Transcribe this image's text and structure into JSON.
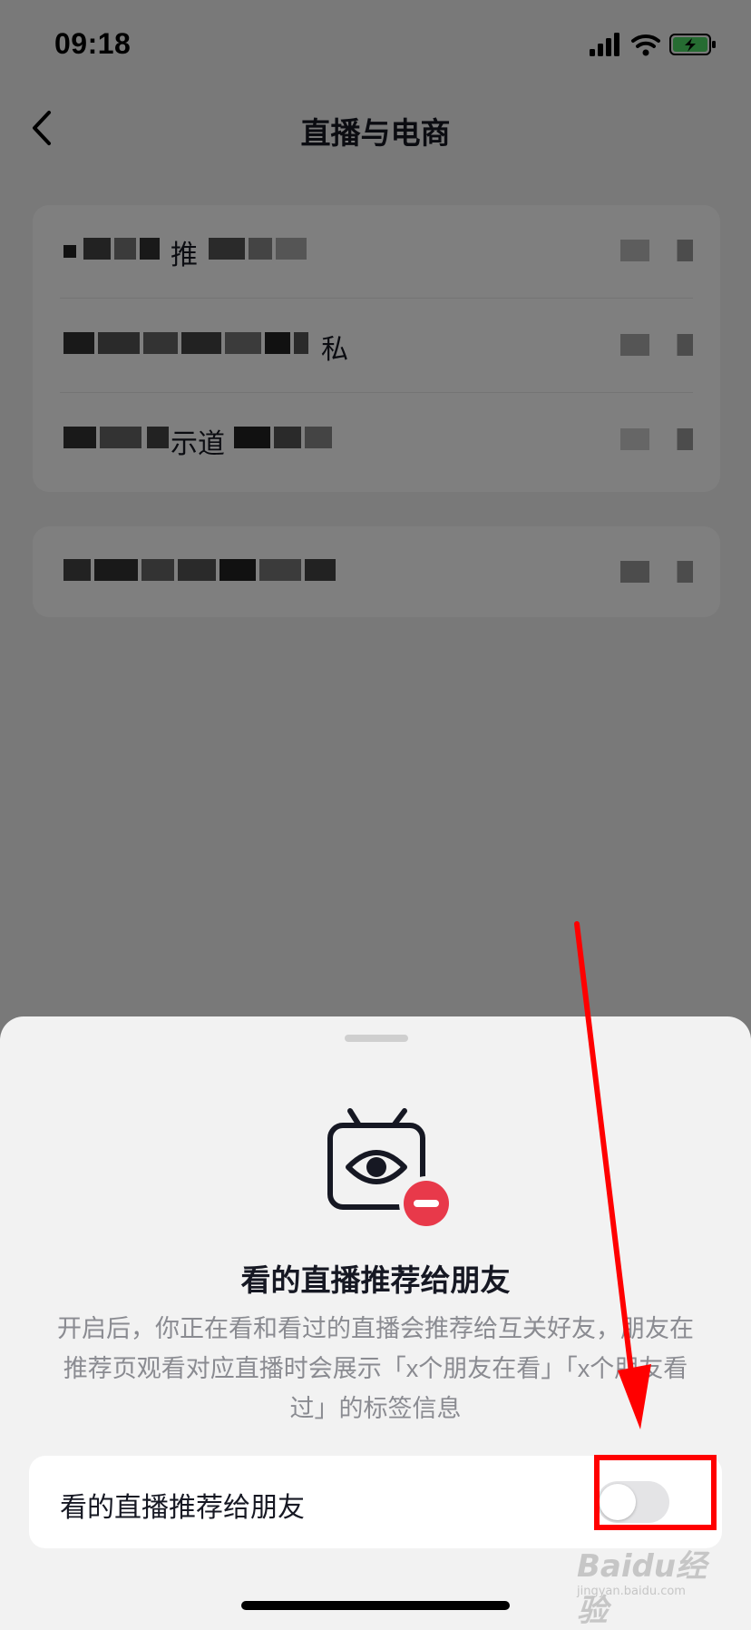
{
  "status_bar": {
    "time": "09:18"
  },
  "nav": {
    "title": "直播与电商",
    "back_icon": "chevron-left-icon"
  },
  "settings_rows": [
    {
      "visible_text": "推",
      "blurred": true
    },
    {
      "visible_text": "私",
      "blurred": true
    },
    {
      "visible_text": "示道",
      "blurred": true
    },
    {
      "visible_text": "",
      "blurred": true
    }
  ],
  "sheet": {
    "icon": "tv-eye-minus-icon",
    "title": "看的直播推荐给朋友",
    "description": "开启后，你正在看和看过的直播会推荐给互关好友，朋友在推荐页观看对应直播时会展示「x个朋友在看」「x个朋友看过」的标签信息",
    "toggle": {
      "label": "看的直播推荐给朋友",
      "on": false
    }
  },
  "watermark": {
    "main": "Baidu经验",
    "sub": "jingyan.baidu.com"
  },
  "colors": {
    "page_bg": "#f2f2f2",
    "card_bg": "#ffffff",
    "text_primary": "#161823",
    "text_secondary": "#8a8b91",
    "badge_red": "#e8394a",
    "annotation_red": "#ff0000",
    "toggle_off": "#e4e4e6"
  }
}
